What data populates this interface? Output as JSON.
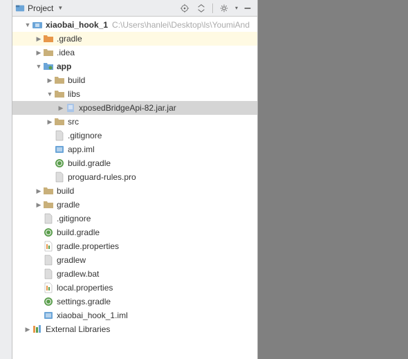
{
  "header": {
    "title": "Project"
  },
  "root": {
    "name": "xiaobai_hook_1",
    "path": "C:\\Users\\hanlei\\Desktop\\ls\\YoumiAnd"
  },
  "tree": {
    "gradle_dir": ".gradle",
    "idea_dir": ".idea",
    "app": "app",
    "app_build": "build",
    "app_libs": "libs",
    "xposed_jar": "xposedBridgeApi-82.jar.jar",
    "app_src": "src",
    "app_gitignore": ".gitignore",
    "app_iml": "app.iml",
    "app_build_gradle": "build.gradle",
    "app_proguard": "proguard-rules.pro",
    "build": "build",
    "gradle": "gradle",
    "gitignore": ".gitignore",
    "build_gradle": "build.gradle",
    "gradle_properties": "gradle.properties",
    "gradlew": "gradlew",
    "gradlew_bat": "gradlew.bat",
    "local_properties": "local.properties",
    "settings_gradle": "settings.gradle",
    "project_iml": "xiaobai_hook_1.iml",
    "external_libs": "External Libraries"
  }
}
